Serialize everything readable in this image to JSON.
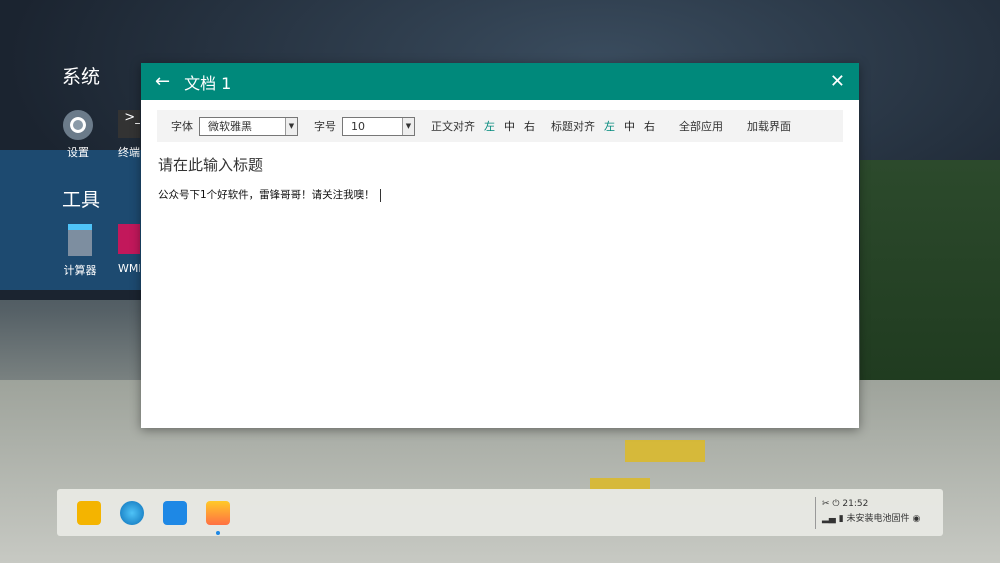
{
  "desktop": {
    "sections": [
      {
        "label": "系统",
        "apps": [
          {
            "label": "设置",
            "icon": "gear-icon"
          },
          {
            "label": "终端",
            "icon": "terminal-icon"
          }
        ]
      },
      {
        "label": "工具",
        "apps": [
          {
            "label": "计算器",
            "icon": "calculator-icon"
          },
          {
            "label": "WMP",
            "icon": "media-player-icon"
          }
        ]
      }
    ]
  },
  "window": {
    "title": "文档 1",
    "accent": "#00897b",
    "toolbar": {
      "font_label": "字体",
      "font_value": "微软雅黑",
      "size_label": "字号",
      "size_value": "10",
      "body_align_label": "正文对齐",
      "title_align_label": "标题对齐",
      "align_options": [
        "左",
        "中",
        "右"
      ],
      "apply_all": "全部应用",
      "load_ui": "加载界面"
    },
    "title_placeholder": "请在此输入标题",
    "body": "公众号下1个好软件，雷锋哥哥！请关注我噢！"
  },
  "taskbar": {
    "time": "21:52",
    "battery_status": "未安装电池固件"
  }
}
